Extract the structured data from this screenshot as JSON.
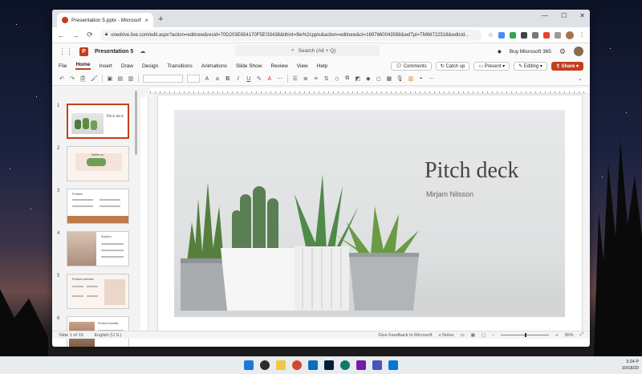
{
  "browser": {
    "tab_title": "Presentation 5.pptx - Microsoft",
    "tab_close": "×",
    "new_tab": "+",
    "url": "onedrive.live.com/edit.aspx?action=editnew&resid=70D203E654170F5E!33438&ithint=file%2cpptx&action=editnew&ct=1697660043598&wdTpl=TM66722518&wdlcid...",
    "win_min": "—",
    "win_max": "☐",
    "win_close": "✕",
    "back": "←",
    "forward": "→",
    "reload": "⟳"
  },
  "office": {
    "app_letter": "P",
    "doc_name": "Presentation 5",
    "search_placeholder": "Search (Alt + Q)",
    "buy": "Buy Microsoft 365",
    "ribbon_tabs": [
      "File",
      "Home",
      "Insert",
      "Draw",
      "Design",
      "Transitions",
      "Animations",
      "Slide Show",
      "Review",
      "View",
      "Help"
    ],
    "comments": "Comments",
    "catch_up": "Catch up",
    "present": "Present",
    "editing": "Editing",
    "share": "Share"
  },
  "thumbnails": [
    "1",
    "2",
    "3",
    "4",
    "5",
    "6"
  ],
  "slide": {
    "title": "Pitch deck",
    "subtitle": "Mirjam Nilsson"
  },
  "thumb_texts": {
    "t1": "Pitch deck",
    "t2": "Define us",
    "t3": "Problem",
    "t4": "Solution",
    "t5": "Product overview",
    "t6": "Product benefits"
  },
  "statusbar": {
    "slide_count": "Slide 1 of 19",
    "language": "English (U.S.)",
    "feedback": "Give Feedback to Microsoft",
    "notes": "Notes",
    "zoom": "95%"
  },
  "taskbar": {
    "time": "3:24 P",
    "date": "10/18/20"
  }
}
